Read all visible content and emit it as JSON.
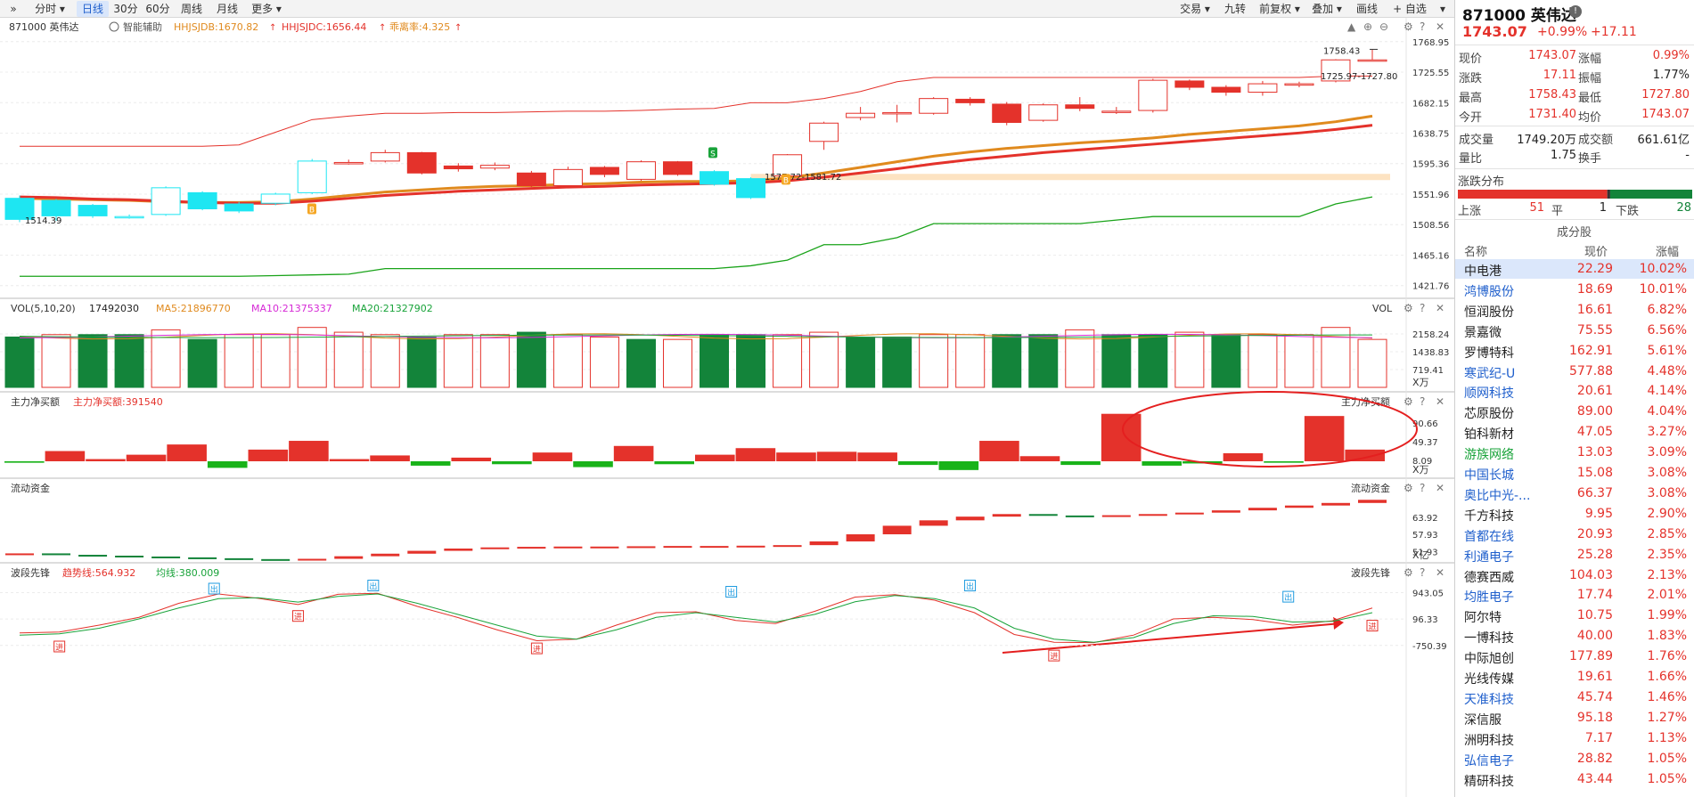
{
  "toolbar": {
    "left": [
      {
        "label": "»",
        "w": 22
      },
      {
        "label": "分时 ▾",
        "w": 56
      },
      {
        "label": "日线",
        "w": 36,
        "active": true
      },
      {
        "label": "30分",
        "w": 34
      },
      {
        "label": "60分",
        "w": 34
      },
      {
        "label": "周线",
        "w": 38
      },
      {
        "label": "月线",
        "w": 38
      },
      {
        "label": "更多 ▾",
        "w": 46
      }
    ],
    "right": [
      {
        "label": "交易 ▾",
        "w": 46
      },
      {
        "label": "九转",
        "w": 40
      },
      {
        "label": "前复权 ▾",
        "w": 56
      },
      {
        "label": "叠加 ▾",
        "w": 46
      },
      {
        "label": "画线",
        "w": 40
      },
      {
        "label": "+ 自选",
        "w": 52
      },
      {
        "label": "▾",
        "w": 18
      }
    ]
  },
  "main_panel": {
    "symbol": "871000 英伟达",
    "assist": "智能辅助",
    "ind1": "HHJSJDB:1670.82",
    "ind2": "HHJSJDC:1656.44",
    "ind3": "乖离率:4.325",
    "axis": [
      "1768.95",
      "1725.55",
      "1682.15",
      "1638.75",
      "1595.36",
      "1551.96",
      "1508.56",
      "1465.16",
      "1421.76"
    ],
    "high_label": "1758.43",
    "range_label": "1725.97-1727.80",
    "low_label": "1514.39",
    "mid_label": "1577.72-1581.72",
    "buy_label": "B",
    "sell_label": "S"
  },
  "vol_panel": {
    "title": "VOL(5,10,20)",
    "value": "17492030",
    "ma5": "MA5:21896770",
    "ma10": "MA10:21375337",
    "ma20": "MA20:21327902",
    "right": "VOL",
    "axis": [
      "2158.24",
      "1438.83",
      "719.41"
    ],
    "unit": "X万"
  },
  "net_panel": {
    "title": "主力净买额",
    "value": "主力净买额:391540",
    "right": "主力净买额",
    "axis": [
      "90.66",
      "49.37",
      "8.09"
    ],
    "unit": "X万"
  },
  "flow_panel": {
    "title": "流动资金",
    "right": "流动资金",
    "axis": [
      "63.92",
      "57.93",
      "51.93"
    ],
    "unit": "X亿"
  },
  "wave_panel": {
    "title": "波段先锋",
    "trend": "趋势线:564.932",
    "avg": "均线:380.009",
    "right": "波段先锋",
    "axis": [
      "943.05",
      "96.33",
      "-750.39"
    ],
    "out_label": "出",
    "in_label": "进"
  },
  "colors": {
    "up": "#e4322b",
    "down": "#13843a",
    "cyan": "#1ee6f2",
    "orange": "#e08a1e",
    "green": "#19b319"
  },
  "stock": {
    "title": "871000 英伟达",
    "price": "1743.07",
    "change_pct": "+0.99%",
    "change": "+17.11"
  },
  "quote": [
    {
      "l1": "现价",
      "v1": "1743.07",
      "l2": "涨幅",
      "v2": "0.99%"
    },
    {
      "l1": "涨跌",
      "v1": "17.11",
      "l2": "振幅",
      "v2": "1.77%",
      "c2": "k"
    },
    {
      "l1": "最高",
      "v1": "1758.43",
      "l2": "最低",
      "v2": "1727.80"
    },
    {
      "l1": "今开",
      "v1": "1731.40",
      "l2": "均价",
      "v2": "1743.07"
    }
  ],
  "quote2": [
    {
      "l1": "成交量",
      "v1": "1749.20万",
      "l2": "成交额",
      "v2": "661.61亿"
    },
    {
      "l1": "量比",
      "v1": "1.75",
      "l2": "换手",
      "v2": "-"
    }
  ],
  "dist": {
    "title": "涨跌分布",
    "up_label": "上涨",
    "up": "51",
    "flat_label": "平",
    "flat": "1",
    "down_label": "下跌",
    "down": "28"
  },
  "constituents": {
    "title": "成分股",
    "headers": [
      "名称",
      "现价",
      "涨幅"
    ],
    "rows": [
      {
        "name": "中电港",
        "price": "22.29",
        "chg": "10.02%",
        "c": "#222"
      },
      {
        "name": "鸿博股份",
        "price": "18.69",
        "chg": "10.01%",
        "c": "#1f5fcc"
      },
      {
        "name": "恒润股份",
        "price": "16.61",
        "chg": "6.82%",
        "c": "#222"
      },
      {
        "name": "景嘉微",
        "price": "75.55",
        "chg": "6.56%",
        "c": "#222"
      },
      {
        "name": "罗博特科",
        "price": "162.91",
        "chg": "5.61%",
        "c": "#222"
      },
      {
        "name": "寒武纪-U",
        "price": "577.88",
        "chg": "4.48%",
        "c": "#1f5fcc"
      },
      {
        "name": "顺网科技",
        "price": "20.61",
        "chg": "4.14%",
        "c": "#1f5fcc"
      },
      {
        "name": "芯原股份",
        "price": "89.00",
        "chg": "4.04%",
        "c": "#222"
      },
      {
        "name": "铂科新材",
        "price": "47.05",
        "chg": "3.27%",
        "c": "#222"
      },
      {
        "name": "游族网络",
        "price": "13.03",
        "chg": "3.09%",
        "c": "#19a33a"
      },
      {
        "name": "中国长城",
        "price": "15.08",
        "chg": "3.08%",
        "c": "#1f5fcc"
      },
      {
        "name": "奥比中光-...",
        "price": "66.37",
        "chg": "3.08%",
        "c": "#1f5fcc"
      },
      {
        "name": "千方科技",
        "price": "9.95",
        "chg": "2.90%",
        "c": "#222"
      },
      {
        "name": "首都在线",
        "price": "20.93",
        "chg": "2.85%",
        "c": "#1f5fcc"
      },
      {
        "name": "利通电子",
        "price": "25.28",
        "chg": "2.35%",
        "c": "#1f5fcc"
      },
      {
        "name": "德赛西威",
        "price": "104.03",
        "chg": "2.13%",
        "c": "#222"
      },
      {
        "name": "均胜电子",
        "price": "17.74",
        "chg": "2.01%",
        "c": "#1f5fcc"
      },
      {
        "name": "阿尔特",
        "price": "10.75",
        "chg": "1.99%",
        "c": "#222"
      },
      {
        "name": "一博科技",
        "price": "40.00",
        "chg": "1.83%",
        "c": "#222"
      },
      {
        "name": "中际旭创",
        "price": "177.89",
        "chg": "1.76%",
        "c": "#222"
      },
      {
        "name": "光线传媒",
        "price": "19.61",
        "chg": "1.66%",
        "c": "#222"
      },
      {
        "name": "天准科技",
        "price": "45.74",
        "chg": "1.46%",
        "c": "#1f5fcc"
      },
      {
        "name": "深信服",
        "price": "95.18",
        "chg": "1.27%",
        "c": "#222"
      },
      {
        "name": "洲明科技",
        "price": "7.17",
        "chg": "1.13%",
        "c": "#222"
      },
      {
        "name": "弘信电子",
        "price": "28.82",
        "chg": "1.05%",
        "c": "#1f5fcc"
      },
      {
        "name": "精研科技",
        "price": "43.44",
        "chg": "1.05%",
        "c": "#222"
      }
    ]
  },
  "chart_data": {
    "type": "candlestick",
    "candles": [
      {
        "o": 1546,
        "c": 1516,
        "h": 1550,
        "l": 1512
      },
      {
        "o": 1543,
        "c": 1521,
        "h": 1545,
        "l": 1514
      },
      {
        "o": 1536,
        "c": 1521,
        "h": 1538,
        "l": 1518
      },
      {
        "o": 1520,
        "c": 1520,
        "h": 1523,
        "l": 1517
      },
      {
        "o": 1523,
        "c": 1561,
        "h": 1563,
        "l": 1521
      },
      {
        "o": 1554,
        "c": 1531,
        "h": 1556,
        "l": 1529
      },
      {
        "o": 1538,
        "c": 1528,
        "h": 1541,
        "l": 1525
      },
      {
        "o": 1539,
        "c": 1552,
        "h": 1554,
        "l": 1536
      },
      {
        "o": 1554,
        "c": 1599,
        "h": 1602,
        "l": 1552
      },
      {
        "o": 1595,
        "c": 1597,
        "h": 1601,
        "l": 1594
      },
      {
        "o": 1599,
        "c": 1611,
        "h": 1615,
        "l": 1597
      },
      {
        "o": 1611,
        "c": 1582,
        "h": 1612,
        "l": 1580
      },
      {
        "o": 1592,
        "c": 1588,
        "h": 1596,
        "l": 1584
      },
      {
        "o": 1589,
        "c": 1593,
        "h": 1597,
        "l": 1586
      },
      {
        "o": 1582,
        "c": 1564,
        "h": 1585,
        "l": 1562
      },
      {
        "o": 1564,
        "c": 1587,
        "h": 1591,
        "l": 1561
      },
      {
        "o": 1590,
        "c": 1580,
        "h": 1592,
        "l": 1576
      },
      {
        "o": 1573,
        "c": 1598,
        "h": 1600,
        "l": 1571
      },
      {
        "o": 1598,
        "c": 1580,
        "h": 1599,
        "l": 1578
      },
      {
        "o": 1584,
        "c": 1566,
        "h": 1586,
        "l": 1564
      },
      {
        "o": 1574,
        "c": 1547,
        "h": 1576,
        "l": 1545
      },
      {
        "o": 1578,
        "c": 1608,
        "h": 1609,
        "l": 1576
      },
      {
        "o": 1627,
        "c": 1653,
        "h": 1655,
        "l": 1615
      },
      {
        "o": 1661,
        "c": 1667,
        "h": 1676,
        "l": 1657
      },
      {
        "o": 1667,
        "c": 1668,
        "h": 1679,
        "l": 1654
      },
      {
        "o": 1667,
        "c": 1688,
        "h": 1690,
        "l": 1665
      },
      {
        "o": 1687,
        "c": 1682,
        "h": 1690,
        "l": 1678
      },
      {
        "o": 1680,
        "c": 1654,
        "h": 1683,
        "l": 1650
      },
      {
        "o": 1657,
        "c": 1679,
        "h": 1681,
        "l": 1655
      },
      {
        "o": 1679,
        "c": 1674,
        "h": 1690,
        "l": 1670
      },
      {
        "o": 1670,
        "c": 1670,
        "h": 1676,
        "l": 1666
      },
      {
        "o": 1671,
        "c": 1714,
        "h": 1716,
        "l": 1668
      },
      {
        "o": 1713,
        "c": 1704,
        "h": 1715,
        "l": 1700
      },
      {
        "o": 1704,
        "c": 1697,
        "h": 1707,
        "l": 1692
      },
      {
        "o": 1697,
        "c": 1709,
        "h": 1713,
        "l": 1692
      },
      {
        "o": 1707,
        "c": 1709,
        "h": 1712,
        "l": 1704
      },
      {
        "o": 1713,
        "c": 1743,
        "h": 1744,
        "l": 1711
      },
      {
        "o": 1743,
        "c": 1743,
        "h": 1758,
        "l": 1742
      }
    ],
    "volume": [
      21,
      22,
      22,
      22,
      24,
      20,
      22,
      22,
      25,
      23,
      22,
      21,
      22,
      22,
      23,
      22,
      21,
      20,
      20,
      22,
      22,
      22,
      23,
      21,
      21,
      22,
      22,
      22,
      22,
      24,
      22,
      22,
      23,
      22,
      22,
      22,
      25,
      20
    ],
    "volume_color": [
      "d",
      "u",
      "d",
      "d",
      "u",
      "d",
      "u",
      "u",
      "u",
      "u",
      "u",
      "d",
      "u",
      "u",
      "d",
      "u",
      "u",
      "d",
      "u",
      "d",
      "d",
      "u",
      "u",
      "d",
      "d",
      "u",
      "u",
      "d",
      "d",
      "u",
      "d",
      "d",
      "u",
      "d",
      "u",
      "u",
      "u",
      "u"
    ],
    "net_buy": [
      -2,
      14,
      3,
      9,
      23,
      -9,
      16,
      28,
      3,
      8,
      -6,
      5,
      -4,
      12,
      -8,
      21,
      -4,
      9,
      18,
      12,
      13,
      12,
      -5,
      -12,
      28,
      7,
      -5,
      65,
      -6,
      -3,
      11,
      -2,
      62,
      16
    ],
    "flow": [
      51.3,
      50.8,
      50.5,
      50.2,
      49.9,
      49.6,
      49.3,
      49.0,
      49.4,
      50.3,
      51.2,
      52.2,
      53.0,
      53.4,
      53.6,
      53.7,
      53.7,
      53.8,
      53.9,
      53.9,
      54.0,
      54.2,
      55.5,
      58.0,
      61.0,
      62.9,
      64.2,
      65.1,
      64.6,
      64.5,
      64.7,
      65.1,
      65.6,
      66.4,
      67.3,
      68.1,
      69.0,
      70.1
    ],
    "wave_trend": [
      -350,
      -320,
      -100,
      150,
      600,
      900,
      760,
      560,
      890,
      920,
      500,
      150,
      -250,
      -600,
      -550,
      -100,
      300,
      330,
      50,
      -50,
      350,
      800,
      880,
      700,
      300,
      -400,
      -650,
      -660,
      -420,
      100,
      150,
      80,
      -100,
      40,
      450
    ],
    "wave_avg": [
      -420,
      -380,
      -200,
      100,
      450,
      750,
      780,
      640,
      820,
      900,
      600,
      250,
      -100,
      -450,
      -550,
      -250,
      150,
      300,
      150,
      0,
      250,
      650,
      850,
      750,
      450,
      -200,
      -550,
      -650,
      -500,
      -50,
      200,
      180,
      0,
      20,
      300
    ],
    "hhjsjdb": 1670.82,
    "hhjsjdc": 1656.44,
    "bias": 4.325
  }
}
